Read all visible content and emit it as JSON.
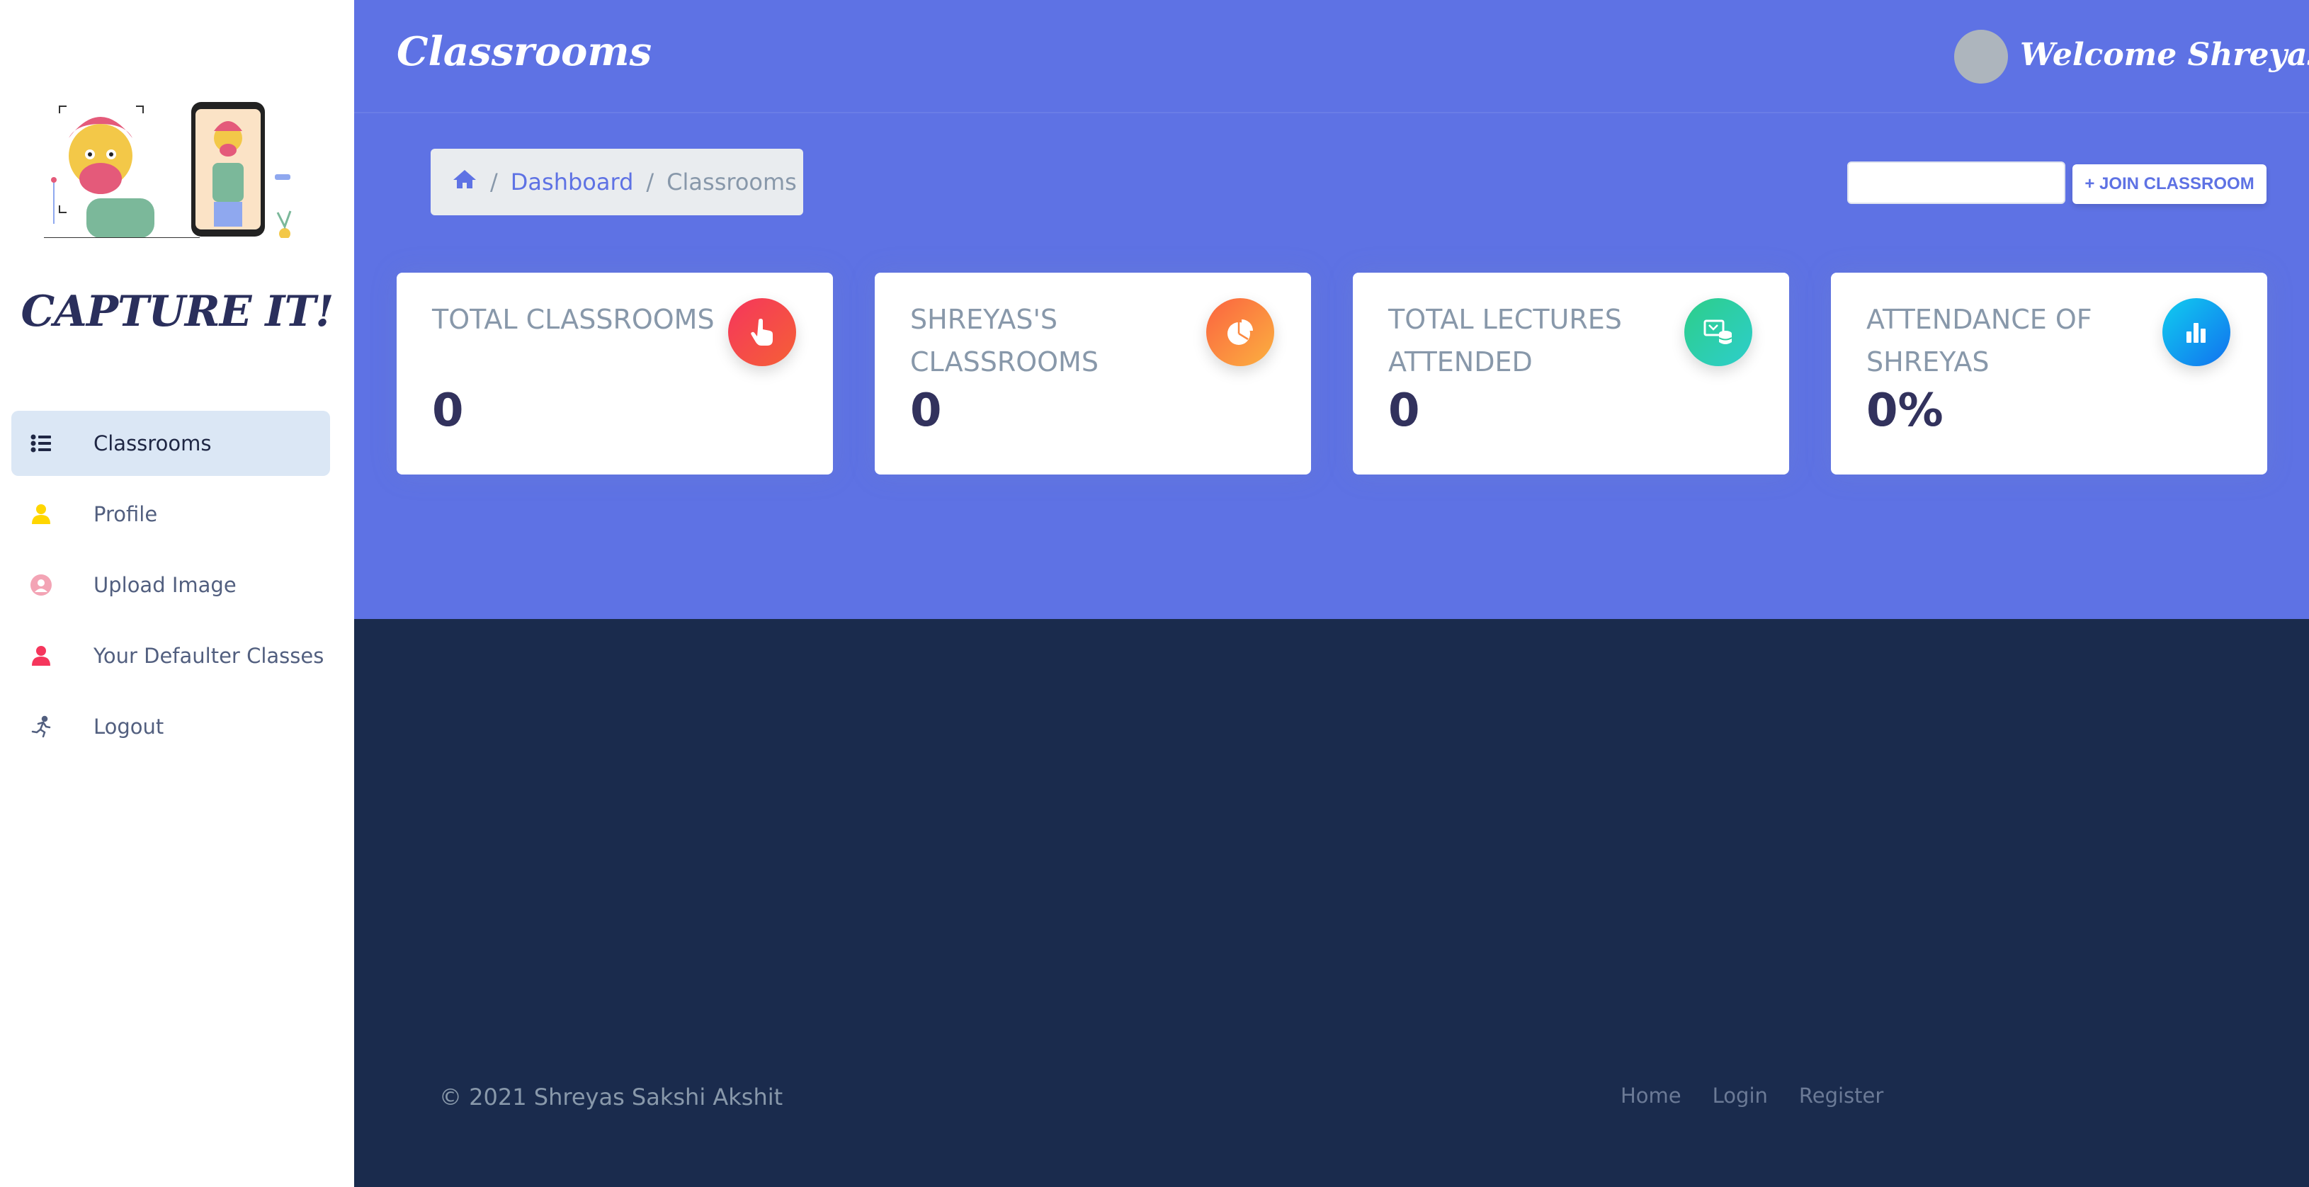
{
  "sidebar": {
    "brand": "CAPTURE IT!",
    "items": [
      {
        "label": "Classrooms",
        "icon": "list-icon",
        "active": true
      },
      {
        "label": "Profile",
        "icon": "user-icon"
      },
      {
        "label": "Upload Image",
        "icon": "face-icon"
      },
      {
        "label": "Your Defaulter Classes",
        "icon": "user-alert-icon"
      },
      {
        "label": "Logout",
        "icon": "running-icon"
      }
    ]
  },
  "header": {
    "title": "Classrooms",
    "welcome": "Welcome Shreyas"
  },
  "breadcrumb": {
    "home_icon": "home-icon",
    "dashboard": "Dashboard",
    "separator": "/",
    "current": "Classrooms"
  },
  "join": {
    "input_value": "",
    "button_label": "+ JOIN CLASSROOM"
  },
  "cards": [
    {
      "title": "TOTAL CLASSROOMS",
      "value": "0",
      "icon": "hand-pointer-icon",
      "color": "#f5365c"
    },
    {
      "title": "SHREYAS'S CLASSROOMS",
      "value": "0",
      "icon": "pie-chart-icon",
      "color": "#fb6340"
    },
    {
      "title": "TOTAL LECTURES ATTENDED",
      "value": "0",
      "icon": "database-monitor-icon",
      "color": "#2dce89"
    },
    {
      "title": "ATTENDANCE OF SHREYAS",
      "value": "0%",
      "icon": "bar-chart-icon",
      "color": "#11cdef"
    }
  ],
  "footer": {
    "copyright": "© 2021 Shreyas Sakshi Akshit",
    "links": [
      "Home",
      "Login",
      "Register"
    ]
  },
  "colors": {
    "primary": "#5e72e4",
    "dark": "#1a2b4d",
    "sidebar_active": "#dbe7f5"
  }
}
